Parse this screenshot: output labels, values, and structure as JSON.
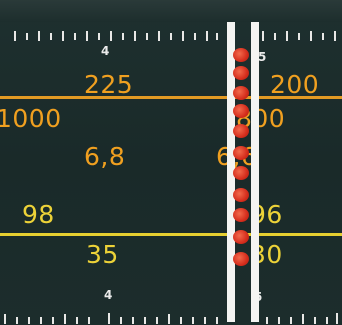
{
  "scale": {
    "top_marks": [
      "4",
      "5"
    ],
    "bottom_marks": [
      "4",
      "5"
    ]
  },
  "bands": {
    "row1": {
      "left": "225",
      "right": "200"
    },
    "row2": {
      "left": "1000",
      "right": "800"
    },
    "row3": {
      "left": "6,8",
      "right": "6,6"
    },
    "row4": {
      "left": "98",
      "right": "96"
    },
    "row5": {
      "left": "35",
      "right": "30"
    }
  },
  "colors": {
    "orange": "#f0a020",
    "yellow": "#ecd238",
    "background": "#1b2b2a",
    "pointer": "#f4f4f2",
    "indicator": "#d52d1c"
  },
  "icons": [
    "tuning-pointer",
    "station-indicator-dots"
  ]
}
